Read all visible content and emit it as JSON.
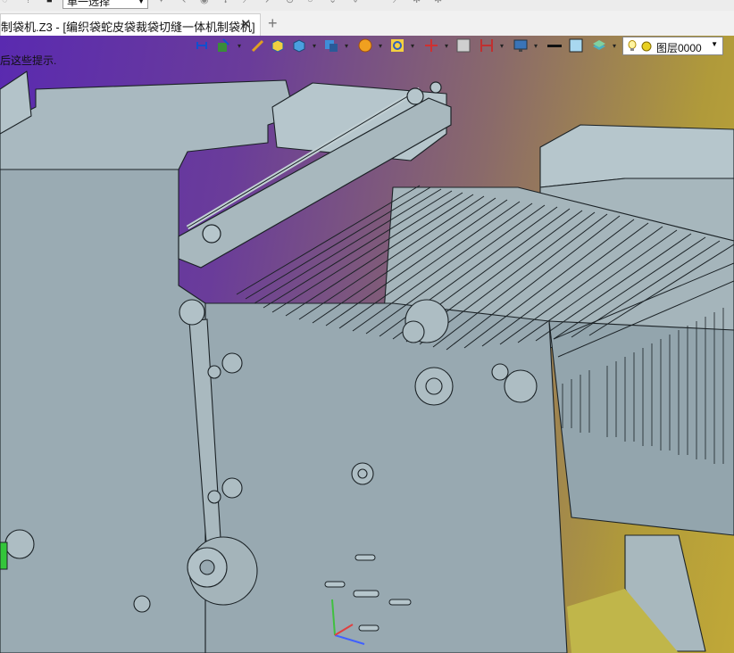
{
  "top_toolbar": {
    "selection_filter": "单一选择"
  },
  "tab": {
    "title": "制袋机.Z3 - [编织袋蛇皮袋裁袋切缝一体机制袋机]",
    "close_glyph": "✕",
    "new_glyph": "+"
  },
  "viewport": {
    "hint_text": "后这些提示.",
    "layer_name": "图层0000"
  },
  "icons": [
    "origin-icon",
    "pointer-icon",
    "pen-icon",
    "shaded-box-icon",
    "cube-icon",
    "views-icon",
    "render-color-icon",
    "zoom-icon",
    "axis-icon",
    "frame-icon",
    "dimension-icon",
    "display-icon",
    "line-style-icon",
    "fill-color-icon",
    "layer-stack-icon",
    "bulb-icon",
    "layer-color-icon"
  ],
  "colors": {
    "machine_face": "#9fb0b8",
    "machine_light": "#b6c6cc",
    "edge": "#1b2226",
    "bg_start": "#5a2ab0",
    "bg_end": "#c0a838"
  }
}
